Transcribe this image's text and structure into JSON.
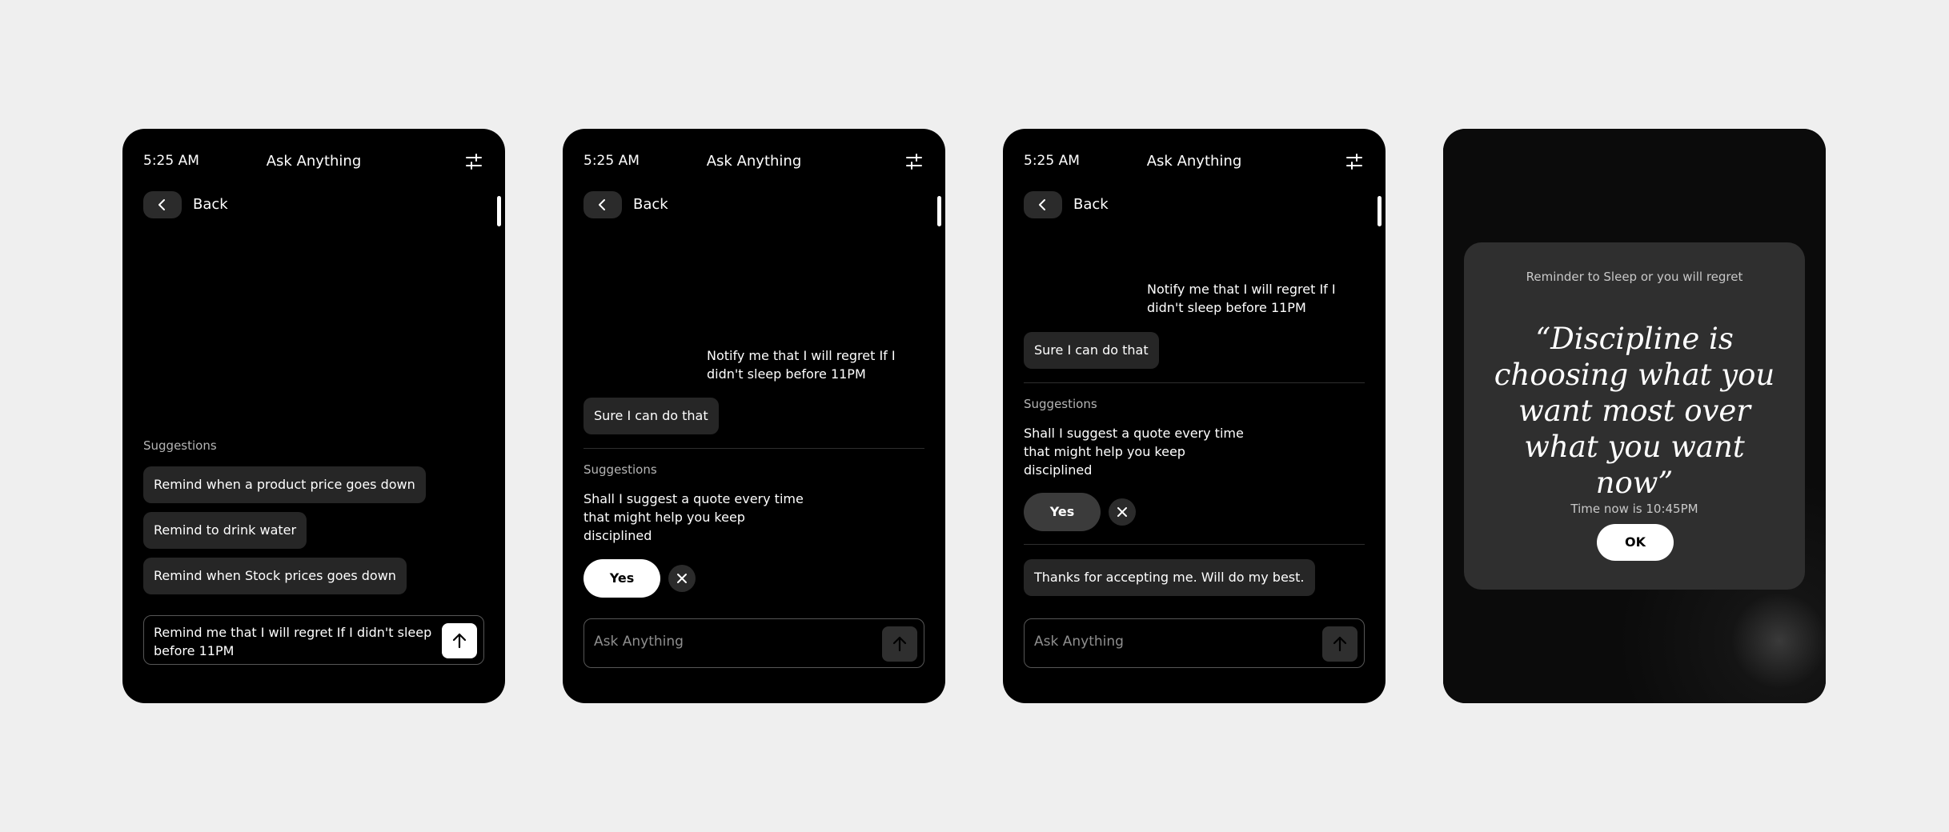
{
  "screens": [
    {
      "time": "5:25 AM",
      "title": "Ask Anything",
      "back_label": "Back",
      "suggestions_heading": "Suggestions",
      "suggestions": [
        "Remind when a product price goes down",
        "Remind to drink water",
        "Remind when Stock prices goes down"
      ],
      "input_value": "Remind me that I will regret If I didn't sleep before 11PM"
    },
    {
      "time": "5:25 AM",
      "title": "Ask Anything",
      "back_label": "Back",
      "user_message": "Notify me that I will regret If I didn't sleep before 11PM",
      "bot_reply": "Sure I can do that",
      "suggestions_heading": "Suggestions",
      "suggestion_text": "Shall I suggest a quote every time that might help you keep disciplined",
      "yes_label": "Yes",
      "input_placeholder": "Ask Anything"
    },
    {
      "time": "5:25 AM",
      "title": "Ask Anything",
      "back_label": "Back",
      "user_message": "Notify me that I will regret If I didn't sleep before 11PM",
      "bot_reply": "Sure I can do that",
      "suggestions_heading": "Suggestions",
      "suggestion_text": "Shall I suggest a quote every time that might help you keep disciplined",
      "yes_label": "Yes",
      "bot_followup": "Thanks for accepting me. Will do my best.",
      "input_placeholder": "Ask Anything"
    },
    {
      "reminder_heading": "Reminder to Sleep or you will regret",
      "quote": "“Discipline is choosing what you want most over what you want now”",
      "time_now": "Time now is 10:45PM",
      "ok_label": "OK"
    }
  ],
  "icons": {
    "filter": "sliders-icon",
    "back": "chevron-left-icon",
    "close": "close-icon",
    "send": "arrow-up-icon"
  },
  "colors": {
    "page_bg": "#efefef",
    "device_bg": "#000000",
    "chip_bg": "#262626",
    "modal_bg": "#2f2f2f",
    "accent": "#ffffff"
  }
}
